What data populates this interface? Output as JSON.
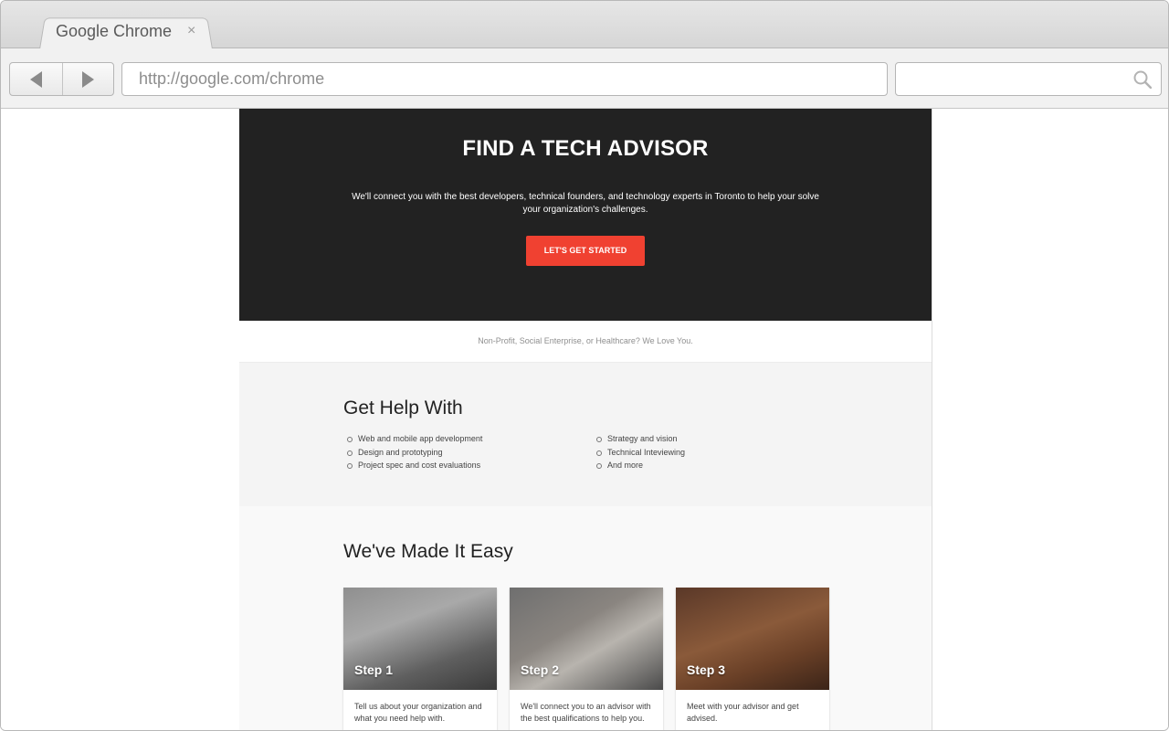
{
  "browser": {
    "tab_title": "Google Chrome",
    "tab_close": "×",
    "url": "http://google.com/chrome",
    "search_placeholder": ""
  },
  "hero": {
    "title": "FIND A TECH ADVISOR",
    "description": "We'll connect you with the best developers, technical founders, and technology experts in Toronto to help your solve your organization's challenges.",
    "cta_label": "LET'S GET STARTED",
    "background_color": "#222222",
    "cta_color": "#f04131"
  },
  "tagline": "Non-Profit, Social Enterprise, or Healthcare? We Love You.",
  "help": {
    "title": "Get Help With",
    "column1": [
      "Web and mobile app development",
      "Design and prototyping",
      "Project spec and cost evaluations"
    ],
    "column2": [
      "Strategy and vision",
      "Technical Inteviewing",
      "And more"
    ]
  },
  "easy": {
    "title": "We've Made It Easy",
    "cards": [
      {
        "title": "Step 1",
        "text": "Tell us about your organization and what you need help with."
      },
      {
        "title": "Step 2",
        "text": "We'll connect you to an advisor with the best qualifications to help you."
      },
      {
        "title": "Step 3",
        "text": "Meet with your advisor and get advised."
      }
    ]
  }
}
